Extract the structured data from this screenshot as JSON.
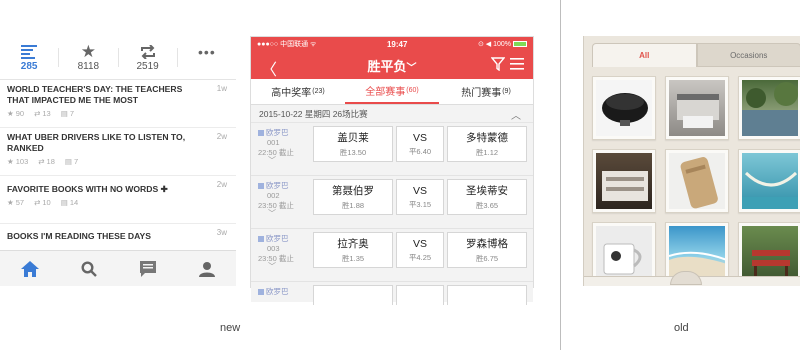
{
  "captions": {
    "new": "new",
    "old": "old"
  },
  "panel1": {
    "tabs": [
      {
        "icon": "list-icon",
        "count": "285",
        "active": true
      },
      {
        "icon": "star-icon",
        "count": "8118",
        "active": false
      },
      {
        "icon": "repost-icon",
        "count": "2519",
        "active": false
      },
      {
        "icon": "more-icon",
        "count": "",
        "active": false
      }
    ],
    "items": [
      {
        "title": "WORLD TEACHER'S DAY: THE TEACHERS THAT IMPACTED ME THE MOST",
        "age": "1w",
        "stars": "90",
        "reposts": "13",
        "comments": "7"
      },
      {
        "title": "WHAT UBER DRIVERS LIKE TO LISTEN TO, RANKED",
        "age": "2w",
        "stars": "103",
        "reposts": "18",
        "comments": "7"
      },
      {
        "title": "FAVORITE BOOKS WITH NO WORDS ✚",
        "age": "2w",
        "stars": "57",
        "reposts": "10",
        "comments": "14"
      },
      {
        "title": "BOOKS I'M READING THESE DAYS",
        "age": "3w",
        "stars": "",
        "reposts": "",
        "comments": ""
      }
    ],
    "bottom_icons": [
      "home-icon",
      "search-icon",
      "chat-icon",
      "profile-icon"
    ],
    "accent": "#3a7bd5"
  },
  "panel2": {
    "status": {
      "left": "●●●○○ 中国联通 ᯤ",
      "time": "19:47",
      "right": "⊙ ◀ 100%"
    },
    "title": "胜平负",
    "tabs": [
      {
        "label": "高中奖率",
        "count": "(23)",
        "active": false
      },
      {
        "label": "全部赛事",
        "count": "(60)",
        "active": true
      },
      {
        "label": "热门赛事",
        "count": "(9)",
        "active": false
      }
    ],
    "date_header": "2015-10-22 星期四  26场比赛",
    "matches": [
      {
        "league": "欧罗巴",
        "num": "001",
        "time": "22:50 截止",
        "home": "盖贝莱",
        "home_odds": "胜13.50",
        "vs": "VS",
        "draw_odds": "平6.40",
        "away": "多特蒙德",
        "away_odds": "胜1.12"
      },
      {
        "league": "欧罗巴",
        "num": "002",
        "time": "23:50 截止",
        "home": "第聂伯罗",
        "home_odds": "胜1.88",
        "vs": "VS",
        "draw_odds": "平3.15",
        "away": "圣埃蒂安",
        "away_odds": "胜3.65"
      },
      {
        "league": "欧罗巴",
        "num": "003",
        "time": "23:50 截止",
        "home": "拉齐奥",
        "home_odds": "胜1.35",
        "vs": "VS",
        "draw_odds": "平4.25",
        "away": "罗森博格",
        "away_odds": "胜6.75"
      },
      {
        "league": "欧罗巴",
        "num": "",
        "time": "",
        "home": "",
        "home_odds": "",
        "vs": "",
        "draw_odds": "",
        "away": "",
        "away_odds": ""
      }
    ],
    "accent": "#e94b4b"
  },
  "panel3": {
    "tabs": [
      {
        "label": "All",
        "active": true
      },
      {
        "label": "Occasions",
        "active": false
      }
    ],
    "photos": [
      "wok-photo",
      "printer-photo",
      "garden-photo",
      "drawer-photo",
      "wood-phone-photo",
      "hammock-photo",
      "mug-photo",
      "beach-photo",
      "bench-photo"
    ],
    "accent": "#e0524a"
  }
}
